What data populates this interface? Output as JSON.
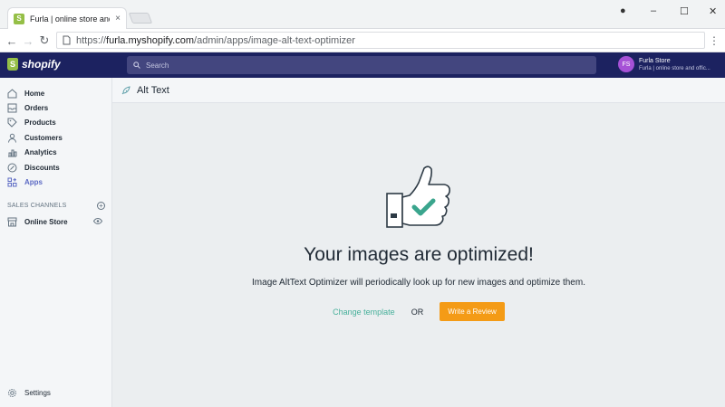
{
  "browser": {
    "tab_title": "Furla | online store and o",
    "tab_close": "×",
    "url_scheme": "https://",
    "url_host": "furla.myshopify.com",
    "url_path": "/admin/apps/image-alt-text-optimizer",
    "window_controls": {
      "account": "●",
      "minimize": "–",
      "maximize": "☐",
      "close": "✕"
    },
    "back": "←",
    "forward": "→",
    "reload": "↻",
    "menu": "⋮"
  },
  "topbar": {
    "logo_text": "shopify",
    "logo_mark": "S",
    "search_placeholder": "Search",
    "store_initials": "FS",
    "store_name": "Furla Store",
    "store_sub": "Furla | online store and offic..."
  },
  "sidebar": {
    "items": [
      {
        "label": "Home",
        "icon": "home-icon",
        "active": false
      },
      {
        "label": "Orders",
        "icon": "orders-icon",
        "active": false
      },
      {
        "label": "Products",
        "icon": "tag-icon",
        "active": false
      },
      {
        "label": "Customers",
        "icon": "person-icon",
        "active": false
      },
      {
        "label": "Analytics",
        "icon": "chart-icon",
        "active": false
      },
      {
        "label": "Discounts",
        "icon": "discount-icon",
        "active": false
      },
      {
        "label": "Apps",
        "icon": "apps-icon",
        "active": true
      }
    ],
    "section_label": "SALES CHANNELS",
    "channels": [
      {
        "label": "Online Store",
        "icon": "store-icon"
      }
    ],
    "settings_label": "Settings"
  },
  "main": {
    "page_title": "Alt Text",
    "headline": "Your images are optimized!",
    "description": "Image AltText Optimizer will periodically look up for new images and optimize them.",
    "link_label": "Change template",
    "or_label": "OR",
    "button_label": "Write a Review"
  },
  "colors": {
    "topbar": "#1c2260",
    "accent": "#5c6ac4",
    "button": "#f49b16",
    "link": "#47b09a",
    "check": "#3aa58d"
  }
}
